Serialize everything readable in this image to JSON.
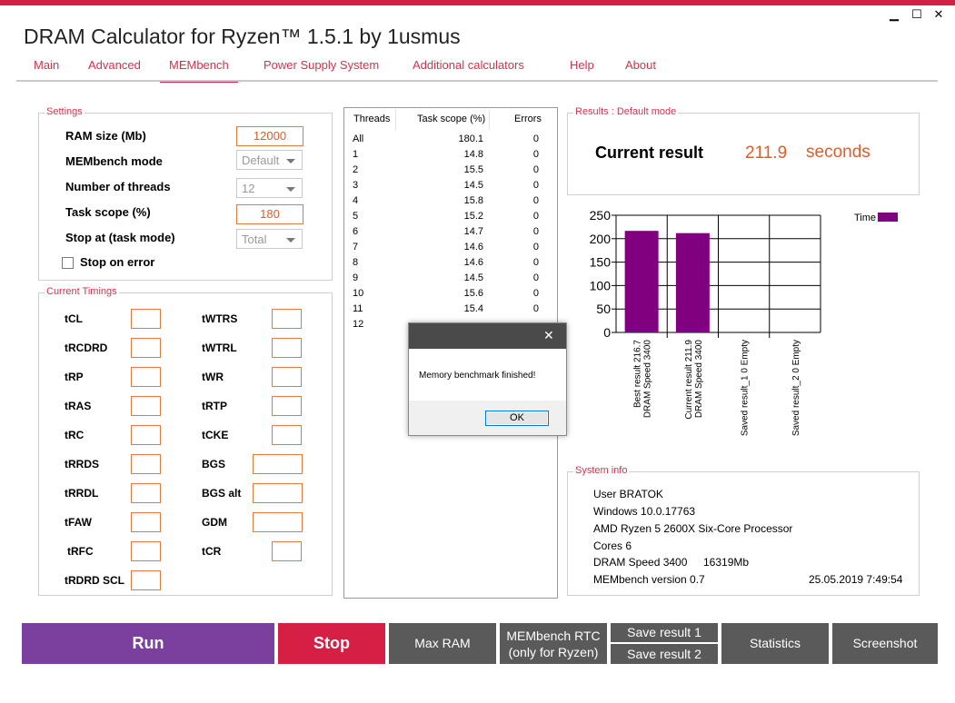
{
  "window": {
    "title": "DRAM Calculator for Ryzen™ 1.5.1 by 1usmus",
    "min": "▁",
    "max": "☐",
    "close": "✕"
  },
  "tabs": [
    "Main",
    "Advanced",
    "MEMbench",
    "Power Supply System",
    "Additional calculators",
    "Help",
    "About"
  ],
  "settings": {
    "legend": "Settings",
    "ram_size_label": "RAM size (Mb)",
    "ram_size_value": "12000",
    "mode_label": "MEMbench mode",
    "mode_value": "Default",
    "threads_label": "Number of threads",
    "threads_value": "12",
    "task_scope_label": "Task scope (%)",
    "task_scope_value": "180",
    "stop_at_label": "Stop at (task mode)",
    "stop_at_value": "Total",
    "stop_on_error_label": "Stop on error"
  },
  "timings": {
    "legend": "Current Timings",
    "left": [
      "tCL",
      "tRCDRD",
      "tRP",
      "tRAS",
      "tRC",
      "tRRDS",
      "tRRDL",
      "tFAW",
      "tRFC",
      "tRDRD SCL"
    ],
    "right": [
      "tWTRS",
      "tWTRL",
      "tWR",
      "tRTP",
      "tCKE",
      "BGS",
      "BGS alt",
      "GDM",
      "tCR"
    ]
  },
  "threads_table": {
    "headers": [
      "Threads",
      "Task scope (%)",
      "Errors"
    ],
    "rows": [
      [
        "All",
        "180.1",
        "0"
      ],
      [
        "1",
        "14.8",
        "0"
      ],
      [
        "2",
        "15.5",
        "0"
      ],
      [
        "3",
        "14.5",
        "0"
      ],
      [
        "4",
        "15.8",
        "0"
      ],
      [
        "5",
        "15.2",
        "0"
      ],
      [
        "6",
        "14.7",
        "0"
      ],
      [
        "7",
        "14.6",
        "0"
      ],
      [
        "8",
        "14.6",
        "0"
      ],
      [
        "9",
        "14.5",
        "0"
      ],
      [
        "10",
        "15.6",
        "0"
      ],
      [
        "11",
        "15.4",
        "0"
      ],
      [
        "12",
        "",
        ""
      ]
    ]
  },
  "results": {
    "legend": "Results : Default mode",
    "current_label": "Current result",
    "current_value": "211.9",
    "unit": "seconds"
  },
  "chart_data": {
    "type": "bar",
    "categories": [
      "Best result 216.7\nDRAM Speed 3400",
      "Current result 211.9\nDRAM Speed 3400",
      "Saved result_1 0 Empty",
      "Saved result_2 0 Empty"
    ],
    "category_lines": [
      [
        "Best result 216.7",
        "DRAM Speed 3400"
      ],
      [
        "Current result 211.9",
        "DRAM Speed 3400"
      ],
      [
        "Saved result_1 0 Empty"
      ],
      [
        "Saved result_2 0 Empty"
      ]
    ],
    "series": [
      {
        "name": "Time",
        "values": [
          216.7,
          211.9,
          0,
          0
        ],
        "color": "#800080"
      }
    ],
    "ylim": [
      0,
      250
    ],
    "yticks": [
      "250",
      "200",
      "150",
      "100",
      "50",
      "0"
    ],
    "legend_position": "top-right",
    "grid": true
  },
  "system_info": {
    "legend": "System info",
    "user": "User BRATOK",
    "os": "Windows 10.0.17763",
    "cpu": "AMD Ryzen 5 2600X Six-Core Processor",
    "cores": "Cores 6",
    "dram_speed": "DRAM Speed 3400",
    "memory": "16319Mb",
    "version": "MEMbench version 0.7",
    "datetime": "25.05.2019 7:49:54"
  },
  "dialog": {
    "message": "Memory benchmark finished!",
    "ok": "OK",
    "close": "✕"
  },
  "buttons": {
    "run": "Run",
    "stop": "Stop",
    "max_ram": "Max RAM",
    "rtc_line1": "MEMbench RTC",
    "rtc_line2": "(only for Ryzen)",
    "save1": "Save result 1",
    "save2": "Save result 2",
    "statistics": "Statistics",
    "screenshot": "Screenshot"
  },
  "colors": {
    "accent": "#d61f45",
    "run": "#7b3f9e",
    "stop": "#d61f45",
    "dark_button": "#5a5a5a",
    "bar": "#800080"
  }
}
